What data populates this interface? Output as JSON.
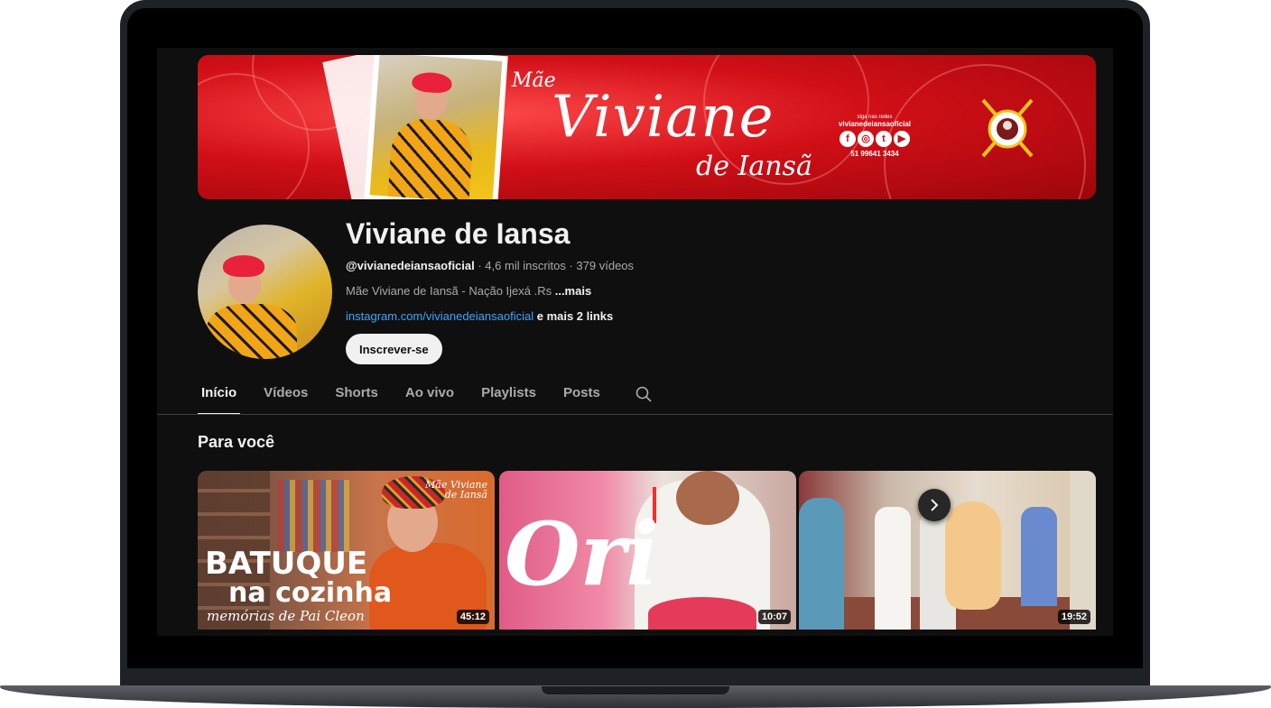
{
  "banner": {
    "mae": "Mãe",
    "name": "Viviane",
    "sub": "de Iansã",
    "social_small": "siga nas redes",
    "social_handle": "vivianedeiansaoficial",
    "social_icons": [
      "f",
      "◎",
      "t",
      "▶"
    ],
    "phone": "51 99641 3434"
  },
  "channel": {
    "title": "Viviane de Iansa",
    "handle": "@vivianedeiansaoficial",
    "stats": " · 4,6 mil inscritos · 379 vídeos",
    "description": "Mãe Viviane de Iansã - Nação Ijexá .Rs ",
    "more": "...mais",
    "link": "instagram.com/vivianedeiansaoficial",
    "more_links": " e mais 2 links",
    "subscribe": "Inscrever-se"
  },
  "tabs": [
    "Início",
    "Vídeos",
    "Shorts",
    "Ao vivo",
    "Playlists",
    "Posts"
  ],
  "section_title": "Para você",
  "videos": [
    {
      "line1": "BATUQUE",
      "line2": "na cozinha",
      "line3": "memórias de Pai Cleon",
      "brand1": "Mãe Viviane",
      "brand2": "de Iansã",
      "duration": "45:12"
    },
    {
      "overlay": "Ori",
      "duration": "10:07"
    },
    {
      "duration": "19:52"
    }
  ],
  "colors": {
    "bg": "#0f0f0f",
    "link": "#3ea6ff",
    "banner_red": "#d10f17"
  }
}
